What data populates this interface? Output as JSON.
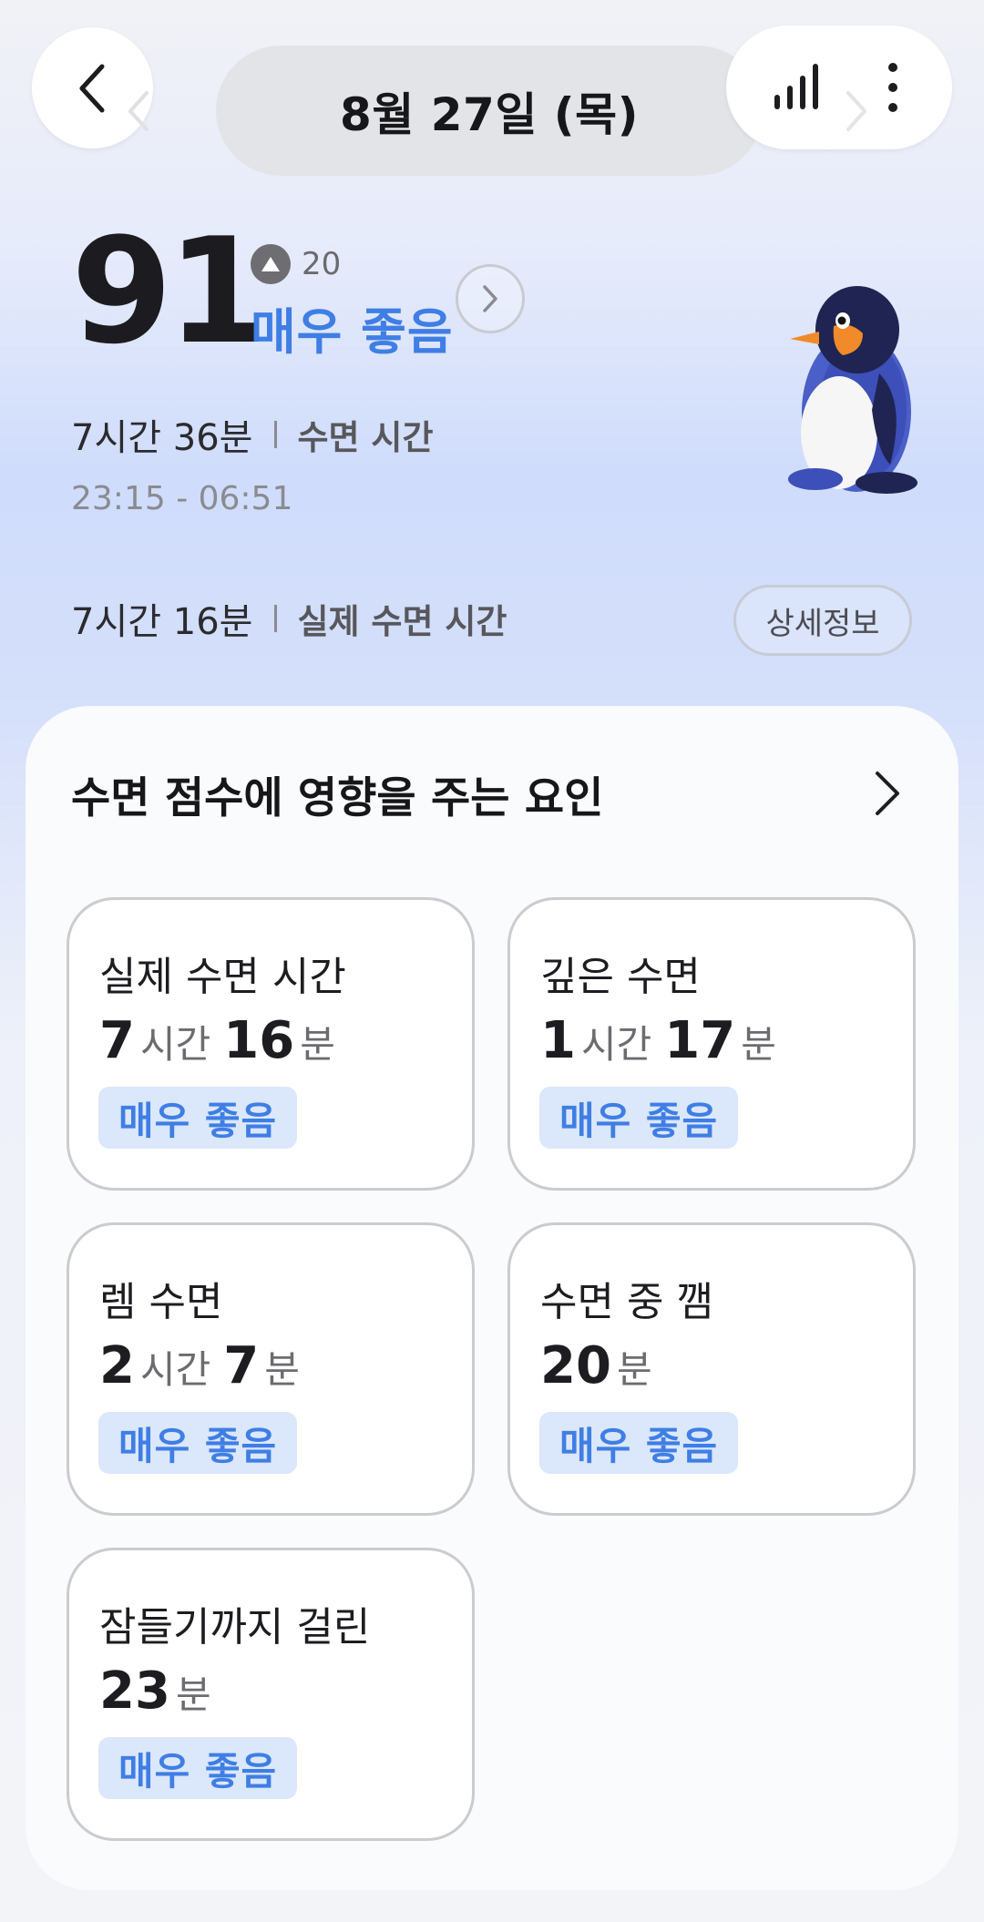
{
  "header": {
    "date": "8월 27일 (목)"
  },
  "summary": {
    "score": "91",
    "delta": "20",
    "rating": "매우 좋음",
    "sleep_time": "7시간 36분",
    "sleep_time_label": "수면 시간",
    "time_range": "23:15 - 06:51",
    "actual_sleep_time": "7시간 16분",
    "actual_sleep_label": "실제 수면 시간",
    "detail_button": "상세정보"
  },
  "factors": {
    "title": "수면 점수에 영향을 주는 요인",
    "items": [
      {
        "title": "실제 수면 시간",
        "value": [
          {
            "num": "7",
            "unit": "시간"
          },
          {
            "num": "16",
            "unit": "분"
          }
        ],
        "badge": "매우 좋음"
      },
      {
        "title": "깊은 수면",
        "value": [
          {
            "num": "1",
            "unit": "시간"
          },
          {
            "num": "17",
            "unit": "분"
          }
        ],
        "badge": "매우 좋음"
      },
      {
        "title": "렘 수면",
        "value": [
          {
            "num": "2",
            "unit": "시간"
          },
          {
            "num": "7",
            "unit": "분"
          }
        ],
        "badge": "매우 좋음"
      },
      {
        "title": "수면 중 깸",
        "value": [
          {
            "num": "20",
            "unit": "분"
          }
        ],
        "badge": "매우 좋음"
      },
      {
        "title": "잠들기까지 걸린",
        "value": [
          {
            "num": "23",
            "unit": "분"
          }
        ],
        "badge": "매우 좋음"
      }
    ]
  },
  "icons": {
    "back": "chevron-left-icon",
    "chart": "bar-chart-icon",
    "more": "more-vertical-icon",
    "score_info": "chevron-right-icon",
    "penguin": "penguin-mascot"
  },
  "colors": {
    "accent": "#3f7ee4",
    "badge_bg": "#dbe7fb"
  }
}
